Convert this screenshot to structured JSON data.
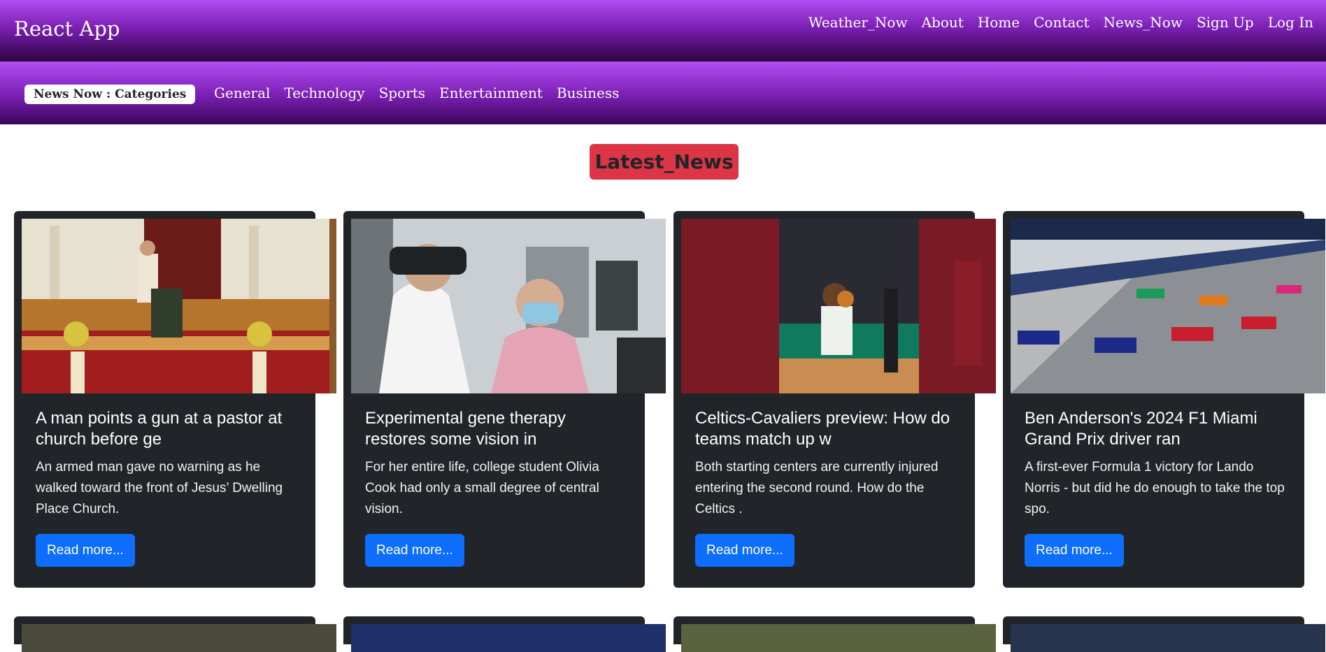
{
  "nav": {
    "brand": "React App",
    "links": [
      "Weather_Now",
      "About",
      "Home",
      "Contact",
      "News_Now",
      "Sign Up",
      "Log In"
    ]
  },
  "categories": {
    "badge": "News Now : Categories",
    "links": [
      "General",
      "Technology",
      "Sports",
      "Entertainment",
      "Business"
    ]
  },
  "heading": "Latest_News",
  "cards": [
    {
      "title": "A man points a gun at a pastor at church before ge",
      "description": "An armed man gave no warning as he walked toward the front of Jesus’ Dwelling Place Church.",
      "button": "Read more..."
    },
    {
      "title": "Experimental gene therapy restores some vision in",
      "description": "For her entire life, college student Olivia Cook had only a small degree of central vision.",
      "button": "Read more..."
    },
    {
      "title": "Celtics-Cavaliers preview: How do teams match up w",
      "description": "Both starting centers are currently injured entering the second round. How do the Celtics .",
      "button": "Read more..."
    },
    {
      "title": "Ben Anderson's 2024 F1 Miami Grand Prix driver ran",
      "description": "A first-ever Formula 1 victory for Lando Norris - but did he do enough to take the top spo.",
      "button": "Read more..."
    }
  ],
  "colors": {
    "nav_gradient_top": "#b24df3",
    "nav_gradient_bottom": "#2e0440",
    "heading_bg": "#dc3545",
    "card_bg": "#212529",
    "button_bg": "#0d6efd"
  }
}
